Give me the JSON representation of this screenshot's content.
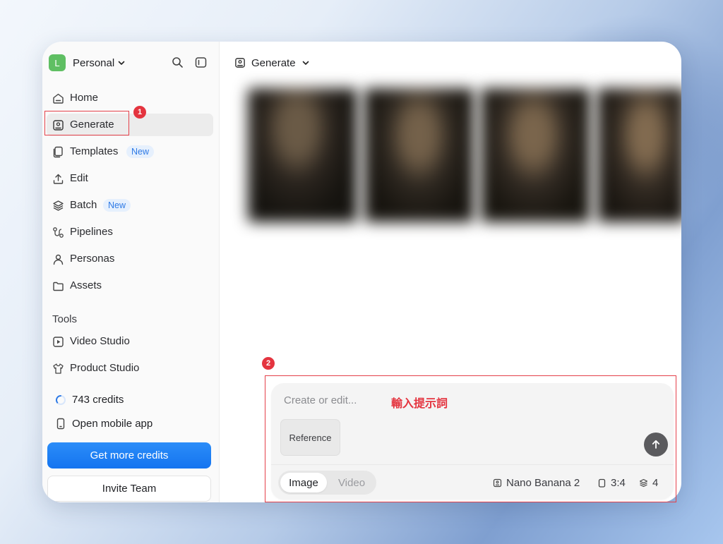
{
  "workspace": {
    "initial": "L",
    "name": "Personal"
  },
  "nav": [
    {
      "label": "Home",
      "icon": "home-icon"
    },
    {
      "label": "Generate",
      "icon": "generate-icon",
      "active": true
    },
    {
      "label": "Templates",
      "icon": "templates-icon",
      "badge": "New"
    },
    {
      "label": "Edit",
      "icon": "upload-icon"
    },
    {
      "label": "Batch",
      "icon": "layers-icon",
      "badge": "New"
    },
    {
      "label": "Pipelines",
      "icon": "pipelines-icon"
    },
    {
      "label": "Personas",
      "icon": "user-icon"
    },
    {
      "label": "Assets",
      "icon": "folder-icon"
    }
  ],
  "tools": {
    "title": "Tools",
    "items": [
      {
        "label": "Video Studio",
        "icon": "play-icon"
      },
      {
        "label": "Product Studio",
        "icon": "shirt-icon"
      }
    ]
  },
  "credits": {
    "label": "743 credits"
  },
  "mobile": {
    "label": "Open mobile app"
  },
  "buttons": {
    "get_credits": "Get more credits",
    "invite": "Invite Team"
  },
  "main": {
    "title": "Generate"
  },
  "composer": {
    "placeholder": "Create or edit...",
    "reference": "Reference",
    "mode_image": "Image",
    "mode_video": "Video",
    "model": "Nano Banana 2",
    "ratio": "3:4",
    "count": "4"
  },
  "annotations": {
    "step1": "1",
    "step2": "2",
    "hint": "輸入提示詞"
  },
  "colors": {
    "accent": "#1474f0",
    "annotation": "#e4343f",
    "avatar": "#5fbf63"
  }
}
